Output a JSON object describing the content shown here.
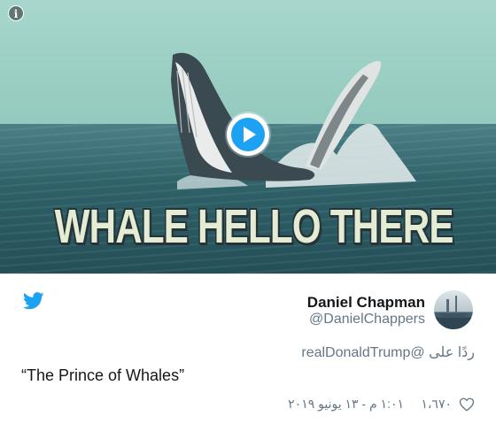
{
  "media": {
    "caption": "WHALE HELLO THERE",
    "info_icon": "info-icon",
    "play_icon": "play-icon"
  },
  "tweet": {
    "author_name": "Daniel Chapman",
    "author_handle": "@DanielChappers",
    "reply_to": "ردًا على @realDonaldTrump",
    "text": "“The Prince of Whales”",
    "like_count": "١،٦٧٠",
    "timestamp": "١:٠١ م - ١٣ يونيو ٢٠١٩",
    "twitter_icon": "twitter-bird-icon",
    "like_icon": "heart-icon"
  },
  "colors": {
    "twitter_blue": "#1da1f2",
    "secondary_text": "#657786",
    "primary_text": "#14171a"
  }
}
